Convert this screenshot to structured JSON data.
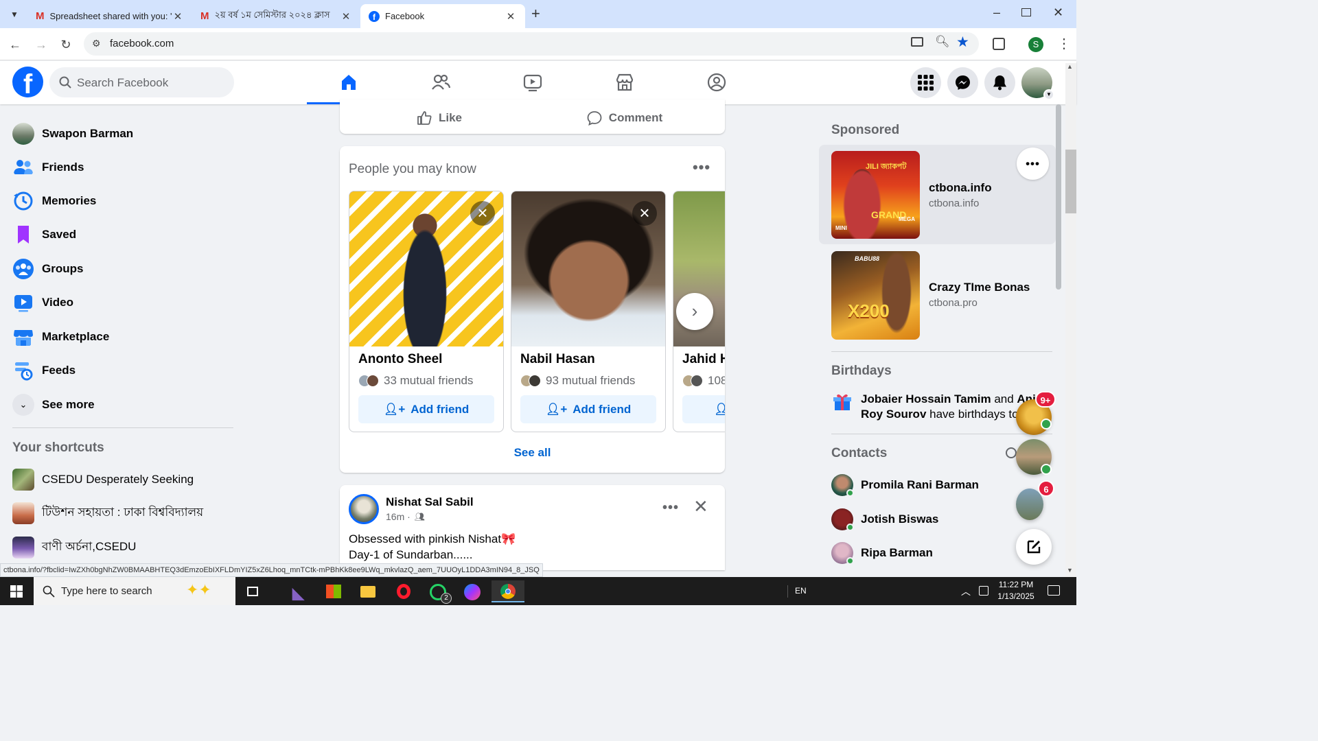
{
  "browser": {
    "tabs": [
      {
        "title": "Spreadsheet shared with you: \"I",
        "icon": "gmail-icon"
      },
      {
        "title": "২য় বর্ষ ১ম সেমিস্টার ২০২৪ ক্লাস",
        "icon": "gmail-icon"
      },
      {
        "title": "Facebook",
        "icon": "facebook-icon"
      }
    ],
    "url": "facebook.com",
    "profile_initial": "S",
    "status_url": "ctbona.info/?fbclid=IwZXh0bgNhZW0BMAABHTEQ3dEmzoEbIXFLDmYIZ5xZ6Lhoq_mnTCtk-mPBhKk8ee9LWq_mkvlazQ_aem_7UUOyL1DDA3mIN94_8_JSQ"
  },
  "header": {
    "search_placeholder": "Search Facebook"
  },
  "left_sidebar": {
    "profile_name": "Swapon Barman",
    "items": [
      {
        "label": "Friends",
        "icon": "friends-icon"
      },
      {
        "label": "Memories",
        "icon": "memories-clock-icon"
      },
      {
        "label": "Saved",
        "icon": "saved-bookmark-icon"
      },
      {
        "label": "Groups",
        "icon": "groups-icon"
      },
      {
        "label": "Video",
        "icon": "video-icon"
      },
      {
        "label": "Marketplace",
        "icon": "marketplace-icon"
      },
      {
        "label": "Feeds",
        "icon": "feeds-icon"
      }
    ],
    "see_more": "See more",
    "shortcuts_title": "Your shortcuts",
    "shortcuts": [
      {
        "label": "CSEDU Desperately Seeking"
      },
      {
        "label": "টিউশন সহায়তা : ঢাকা বিশ্ববিদ্যালয়"
      },
      {
        "label": "বাণী অর্চনা,CSEDU"
      }
    ]
  },
  "feed": {
    "actions": {
      "like": "Like",
      "comment": "Comment"
    },
    "pymk": {
      "title": "People you may know",
      "people": [
        {
          "name": "Anonto Sheel",
          "mutual": "33 mutual friends",
          "button": "Add friend"
        },
        {
          "name": "Nabil Hasan",
          "mutual": "93 mutual friends",
          "button": "Add friend"
        },
        {
          "name": "Jahid H",
          "mutual": "108",
          "button": ""
        }
      ],
      "see_all": "See all"
    },
    "post": {
      "author": "Nishat Sal Sabil",
      "time": "16m ·",
      "line1": "Obsessed with pinkish Nishat🎀",
      "line2": "Day-1 of Sundarban......"
    }
  },
  "right_sidebar": {
    "sponsored_title": "Sponsored",
    "ads": [
      {
        "title": "ctbona.info",
        "domain": "ctbona.info",
        "img_text": [
          "JILI জ্যাকপট",
          "GRAND",
          "MINI",
          "MEGA"
        ]
      },
      {
        "title": "Crazy TIme Bonas",
        "domain": "ctbona.pro",
        "img_text": [
          "BABU88",
          "X200"
        ]
      }
    ],
    "birthdays_title": "Birthdays",
    "birthdays_text_bold1": "Jobaier Hossain Tamim",
    "birthdays_text_and": " and ",
    "birthdays_text_bold2": "Ani",
    "birthdays_line2_bold": "Roy Sourov",
    "birthdays_line2": " have birthdays tod",
    "contacts_title": "Contacts",
    "contacts": [
      {
        "name": "Promila Rani Barman"
      },
      {
        "name": "Jotish Biswas"
      },
      {
        "name": "Ripa Barman"
      }
    ],
    "chat_badges": [
      "9+",
      "6"
    ]
  },
  "taskbar": {
    "search_placeholder": "Type here to search",
    "whatsapp_badge": "2",
    "lang": "EN",
    "time": "11:22 PM",
    "date": "1/13/2025"
  },
  "colors": {
    "fb_blue": "#0866ff",
    "link_blue": "#0064d1",
    "bg": "#f0f2f5",
    "online": "#31a24c",
    "badge_red": "#e41e3f"
  }
}
